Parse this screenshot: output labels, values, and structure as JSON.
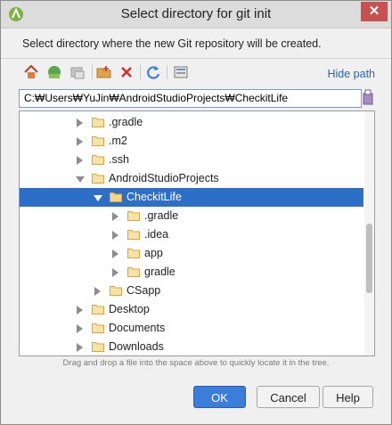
{
  "window": {
    "title": "Select directory for git init",
    "close_glyph": "✕"
  },
  "description": "Select directory where the new Git repository will be created.",
  "toolbar": {
    "icons": [
      "home-icon",
      "project-icon",
      "module-icon",
      "new-folder-icon",
      "delete-icon",
      "refresh-icon",
      "show-hidden-icon"
    ],
    "hide_path_label": "Hide path"
  },
  "path": {
    "value": "C:₩Users₩YuJin₩AndroidStudioProjects₩CheckitLife"
  },
  "tree": {
    "rows": [
      {
        "label": ".gradle",
        "expanded": false,
        "selected": false
      },
      {
        "label": ".m2",
        "expanded": false,
        "selected": false
      },
      {
        "label": ".ssh",
        "expanded": false,
        "selected": false
      },
      {
        "label": "AndroidStudioProjects",
        "expanded": true,
        "selected": false
      },
      {
        "label": "CheckitLife",
        "expanded": true,
        "selected": true
      },
      {
        "label": ".gradle",
        "expanded": false,
        "selected": false
      },
      {
        "label": ".idea",
        "expanded": false,
        "selected": false
      },
      {
        "label": "app",
        "expanded": false,
        "selected": false
      },
      {
        "label": "gradle",
        "expanded": false,
        "selected": false
      },
      {
        "label": "CSapp",
        "expanded": false,
        "selected": false
      },
      {
        "label": "Desktop",
        "expanded": false,
        "selected": false
      },
      {
        "label": "Documents",
        "expanded": false,
        "selected": false
      },
      {
        "label": "Downloads",
        "expanded": false,
        "selected": false
      }
    ]
  },
  "hint": "Drag and drop a file into the space above to quickly locate it in the tree.",
  "buttons": {
    "ok": "OK",
    "cancel": "Cancel",
    "help": "Help"
  },
  "colors": {
    "selection": "#2d6ec7",
    "folder": "#d9a441",
    "link": "#2a66b6",
    "ok_button": "#3b7ddb"
  }
}
